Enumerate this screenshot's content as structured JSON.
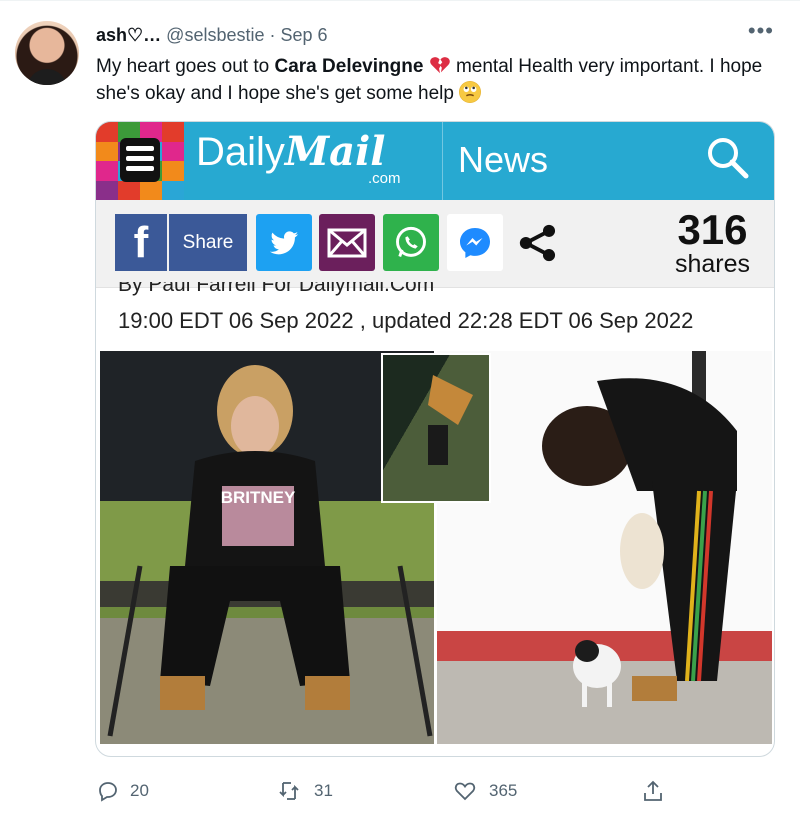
{
  "tweet": {
    "author_name": "ash♡…",
    "handle": "@selsbestie",
    "separator": "·",
    "date": "Sep 6",
    "more_label": "•••",
    "text_before": "My heart goes out to ",
    "text_bold": "Cara Delevingne",
    "text_after_1": " mental Health very important. I hope she's okay and I hope she's get some help ",
    "emoji_1": "broken-heart-icon",
    "emoji_2": "face-with-rolling-eyes-icon"
  },
  "card": {
    "logo_daily": "Daily",
    "logo_mail": "Mail",
    "logo_com": ".com",
    "section": "News",
    "share_label": "Share",
    "fb_glyph": "f",
    "share_count": "316",
    "share_count_label": "shares",
    "byline_partial": "By Paul Farrell For Dailymail.Com",
    "timestamp": "19:00 EDT 06 Sep 2022 , updated 22:28 EDT 06 Sep 2022",
    "photo_left_shirt_text": "BRITNEY"
  },
  "actions": {
    "reply_count": "20",
    "retweet_count": "31",
    "like_count": "365"
  },
  "colors": {
    "dm_blue": "#27a9d1",
    "facebook": "#3b5998",
    "twitter": "#1da1f2",
    "email": "#6b1f5c",
    "whatsapp": "#2fb24c",
    "muted_text": "#536471"
  }
}
